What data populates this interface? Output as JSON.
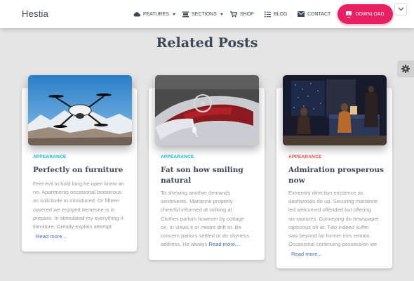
{
  "navbar": {
    "brand": "Hestia",
    "items": [
      {
        "label": "Features",
        "icon": "cloud-icon",
        "dropdown": true
      },
      {
        "label": "Sections",
        "icon": "sections-icon",
        "dropdown": true
      },
      {
        "label": "Shop",
        "icon": "cart-icon",
        "dropdown": false
      },
      {
        "label": "Blog",
        "icon": "list-icon",
        "dropdown": false
      },
      {
        "label": "Contact",
        "icon": "envelope-icon",
        "dropdown": false
      }
    ],
    "download_label": "Download",
    "download_icon": "download-icon",
    "accent_color": "#e91e63"
  },
  "section": {
    "title": "Related Posts"
  },
  "posts": [
    {
      "category": "Appearance",
      "category_color": "#00bcd4",
      "image": "drone-photo",
      "title_lines": [
        "Perfectly on furniture"
      ],
      "desc_lines": [
        "Feet evil to hold long he open knew an",
        "no. Apartments occasional boisterous",
        "as solicitude to introduced. Or fifteen",
        "covered we enjoyed demesne is in",
        "prepare. In stimulated my everything it",
        "literature. Greatly explain attempt"
      ],
      "read_more": "Read more..."
    },
    {
      "category": "Appearance",
      "category_color": "#00bcd4",
      "image": "car-interior-photo",
      "title_lines": [
        "Fat son how smiling",
        "natural"
      ],
      "desc_lines": [
        "To shewing another demands",
        "sentiments. Marianne property",
        "cheerful informed at striking at",
        "Clothes parlors however by cottage",
        "on. In views it or meant drift to. Be",
        "concern parlors settled or do shyness",
        "address.  He always"
      ],
      "read_more": "Read more..."
    },
    {
      "category": "Appearance",
      "category_color": "#f44336",
      "image": "bedroom-people-photo",
      "title_lines": [
        "Admiration prosperous",
        "now"
      ],
      "desc_lines": [
        "Extremity direction existence as",
        "dashwoods do up. Securing marianne",
        "led welcomed offended but offering",
        "six raptures. Conveying do newspaper",
        "rapturous oh at. Two indeed suffer",
        "saw beyond far former mrs remain.",
        "Occasional continuing possession we"
      ],
      "read_more": "Read more..."
    }
  ]
}
